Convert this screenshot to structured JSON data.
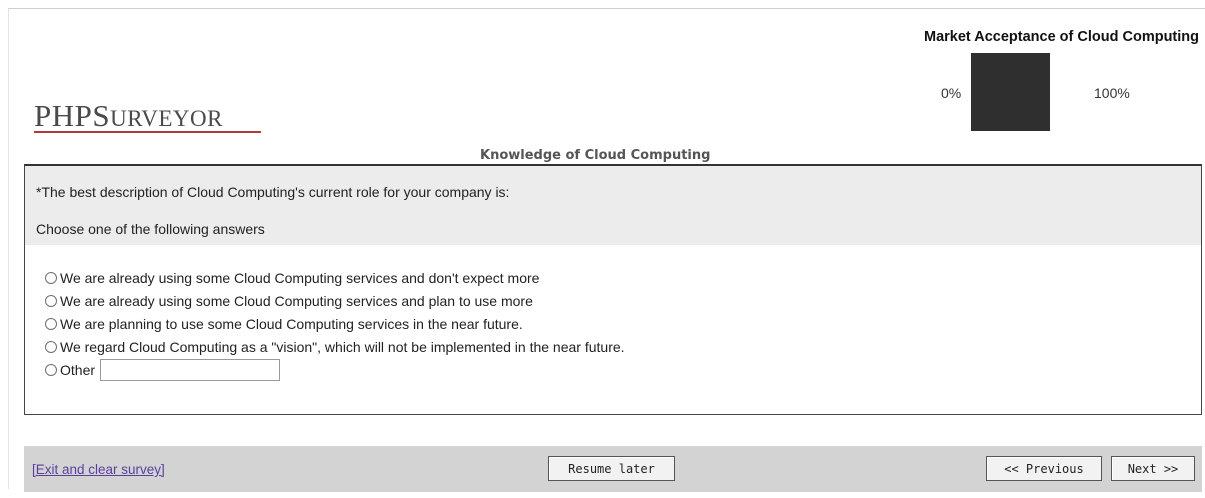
{
  "header": {
    "logo_text": "PHPSurveyor",
    "logo_big_p1": "PHP",
    "logo_big_s": "S",
    "logo_small": "URVEYOR"
  },
  "progress": {
    "title": "Market Acceptance of Cloud Computing",
    "min_label": "0%",
    "max_label": "100%",
    "fraction": 1.0,
    "fill_color": "#2f2f2f"
  },
  "group": {
    "title": "Knowledge of Cloud Computing"
  },
  "question": {
    "text": "*The best description of Cloud Computing's current role for your company is:",
    "help": "Choose one of the following answers",
    "answers": [
      {
        "label": "We are already using some Cloud Computing services and don't expect more"
      },
      {
        "label": "We are already using some Cloud Computing services and plan to use more"
      },
      {
        "label": "We are planning to use some Cloud Computing services in the near future."
      },
      {
        "label": "We regard Cloud Computing as a \"vision\", which will not be implemented in the near future."
      },
      {
        "label": "Other",
        "input_value": ""
      }
    ]
  },
  "footer": {
    "exit_label": "[Exit and clear survey]",
    "resume_label": "Resume later",
    "previous_label": "<< Previous",
    "next_label": "Next >>"
  },
  "colors": {
    "footer_bg": "#d3d3d3",
    "question_head_bg": "#ececec",
    "logo_underline": "#b23a3a",
    "link": "#5b3fa0"
  }
}
